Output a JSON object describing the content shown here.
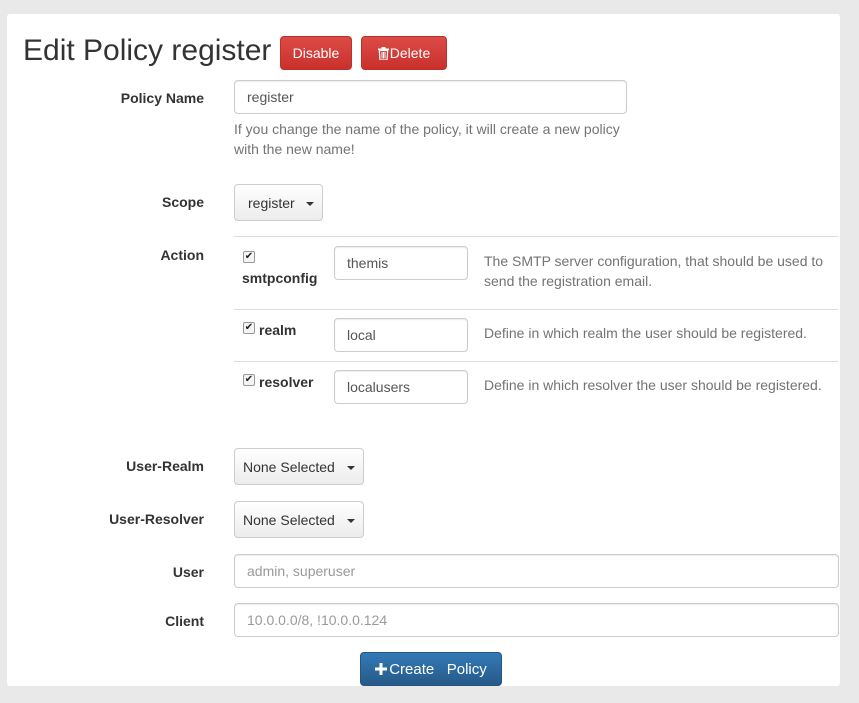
{
  "header": {
    "title": "Edit Policy register",
    "disable_label": "Disable",
    "delete_label": "Delete"
  },
  "form": {
    "policy_name": {
      "label": "Policy Name",
      "value": "register",
      "help": "If you change the name of the policy, it will create a new policy with the new name!"
    },
    "scope": {
      "label": "Scope",
      "selected": "register"
    },
    "action": {
      "label": "Action",
      "items": [
        {
          "name": "smtpconfig",
          "checked": true,
          "value": "themis",
          "description": "The SMTP server configuration, that should be used to send the registration email."
        },
        {
          "name": "realm",
          "checked": true,
          "value": "local",
          "description": "Define in which realm the user should be registered."
        },
        {
          "name": "resolver",
          "checked": true,
          "value": "localusers",
          "description": "Define in which resolver the user should be registered."
        }
      ]
    },
    "user_realm": {
      "label": "User-Realm",
      "selected": "None Selected"
    },
    "user_resolver": {
      "label": "User-Resolver",
      "selected": "None Selected"
    },
    "user": {
      "label": "User",
      "value": "",
      "placeholder": "admin, superuser"
    },
    "client": {
      "label": "Client",
      "value": "",
      "placeholder": "10.0.0.0/8, !10.0.0.124"
    },
    "submit_label": "Create   Policy"
  },
  "icons": {
    "delete": "trash-icon",
    "create": "plus-icon",
    "dropdown": "caret-down-icon",
    "checkbox": "check-icon"
  },
  "colors": {
    "danger": "#d9413c",
    "primary": "#337ab7",
    "background": "#e9e9e9"
  }
}
